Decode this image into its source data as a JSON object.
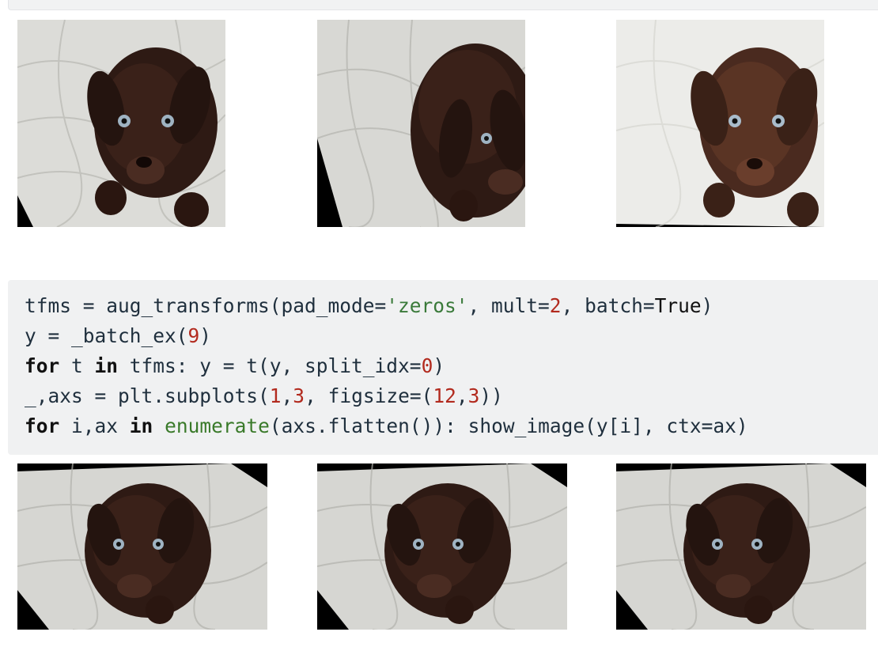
{
  "code_cell": {
    "lines": [
      [
        {
          "t": "tfms = aug_transforms(pad_mode=",
          "c": ""
        },
        {
          "t": "'zeros'",
          "c": "s"
        },
        {
          "t": ", mult=",
          "c": ""
        },
        {
          "t": "2",
          "c": "n"
        },
        {
          "t": ", batch=",
          "c": ""
        },
        {
          "t": "True",
          "c": "c"
        },
        {
          "t": ")",
          "c": ""
        }
      ],
      [
        {
          "t": "y = _batch_ex(",
          "c": ""
        },
        {
          "t": "9",
          "c": "n"
        },
        {
          "t": ")",
          "c": ""
        }
      ],
      [
        {
          "t": "for",
          "c": "k"
        },
        {
          "t": " t ",
          "c": ""
        },
        {
          "t": "in",
          "c": "k"
        },
        {
          "t": " tfms: y = t(y, split_idx=",
          "c": ""
        },
        {
          "t": "0",
          "c": "n"
        },
        {
          "t": ")",
          "c": ""
        }
      ],
      [
        {
          "t": "_,axs = plt.subplots(",
          "c": ""
        },
        {
          "t": "1",
          "c": "n"
        },
        {
          "t": ",",
          "c": ""
        },
        {
          "t": "3",
          "c": "n"
        },
        {
          "t": ", figsize=(",
          "c": ""
        },
        {
          "t": "12",
          "c": "n"
        },
        {
          "t": ",",
          "c": ""
        },
        {
          "t": "3",
          "c": "n"
        },
        {
          "t": "))",
          "c": ""
        }
      ],
      [
        {
          "t": "for",
          "c": "k"
        },
        {
          "t": " i,ax ",
          "c": ""
        },
        {
          "t": "in",
          "c": "k"
        },
        {
          "t": " ",
          "c": ""
        },
        {
          "t": "enumerate",
          "c": "b"
        },
        {
          "t": "(axs.flatten()): show_image(y[i], ctx=ax)",
          "c": ""
        }
      ]
    ]
  },
  "output_images_top": [
    "puppy-image-1",
    "puppy-image-2",
    "puppy-image-3"
  ],
  "output_images_bottom": [
    "puppy-image-4",
    "puppy-image-5",
    "puppy-image-6"
  ],
  "colors": {
    "cell_background": "#f0f1f2",
    "keyword": "#111111",
    "string": "#3a7a3a",
    "number": "#b22a1e",
    "builtin": "#3a7a2a"
  }
}
